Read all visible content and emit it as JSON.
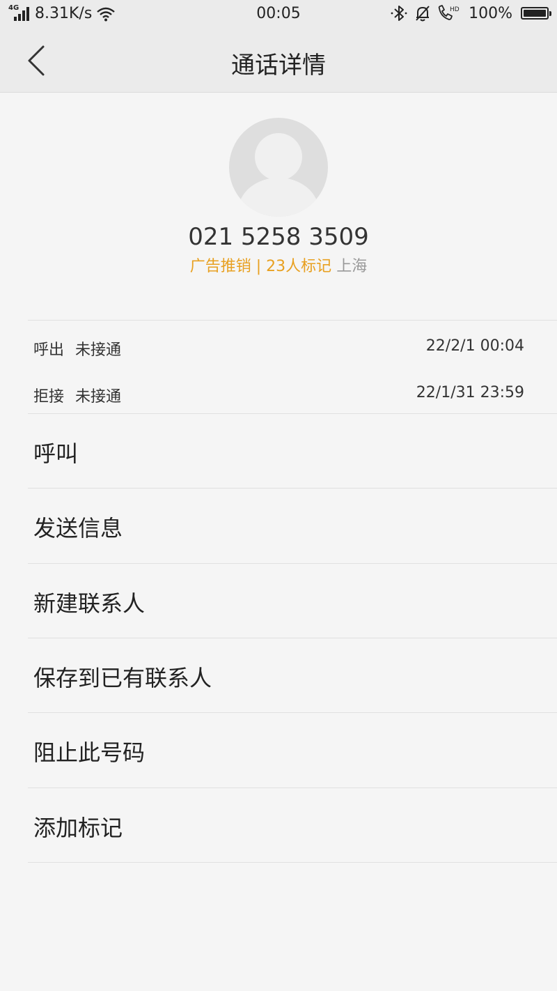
{
  "status_bar": {
    "network": "4G",
    "speed": "8.31K/s",
    "time": "00:05",
    "battery": "100%",
    "battery_level": 1.0,
    "icons": [
      "signal-icon",
      "wifi-icon",
      "bluetooth-icon",
      "bell-muted-icon",
      "hd-call-icon",
      "battery-icon"
    ]
  },
  "nav": {
    "title": "通话详情"
  },
  "contact": {
    "phone": "021 5258 3509",
    "tag": "广告推销 | 23人标记",
    "location": "上海"
  },
  "call_log": [
    {
      "type": "呼出",
      "status": "未接通",
      "time": "22/2/1 00:04"
    },
    {
      "type": "拒接",
      "status": "未接通",
      "time": "22/1/31 23:59"
    }
  ],
  "actions": [
    {
      "label": "呼叫"
    },
    {
      "label": "发送信息"
    },
    {
      "label": "新建联系人"
    },
    {
      "label": "保存到已有联系人"
    },
    {
      "label": "阻止此号码"
    },
    {
      "label": "添加标记"
    }
  ],
  "colors": {
    "tag": "#e8a020",
    "location": "#999999",
    "background": "#f5f5f5",
    "header": "#ebebeb"
  }
}
